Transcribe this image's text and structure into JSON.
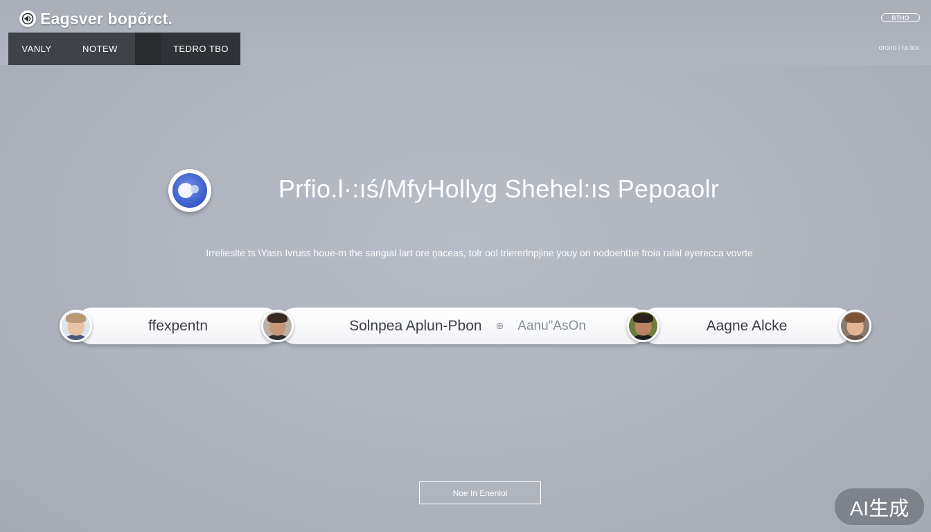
{
  "header": {
    "brand_name": "Eagsver bopőrct.",
    "nav_items": [
      "VANLY",
      "NOTEW",
      "TEDRO TBO"
    ],
    "pill_label": "BTHO",
    "right_link": "oroiro i ra tox"
  },
  "hero": {
    "title": "Prfio.l·:ıś/MfyHollyg Shehel:ıs Pepoaolr",
    "subtitle": "Irrelieslte ts \\Yasn Ivruss houe-m the sangıal lart ore ņaceas, tolr ool triererlnpjine youy on nodoehthe froiə ralal əyerecca vovrte"
  },
  "people": [
    {
      "name": "ffexpentn"
    },
    {
      "name": "Solnpea Aplun-Pbon",
      "secondary": "Aanu\"AsOn",
      "secondary_icon": "⊛"
    },
    {
      "name": "Aagne Alcke"
    }
  ],
  "footer": {
    "cta_label": "Noe In Enenlol",
    "watermark": "AI生成"
  },
  "colors": {
    "background": "#b0b5bf",
    "nav_dark": "#3f4247",
    "pill_text": "#3b3e45",
    "accent_blue": "#4a6fd4"
  },
  "icons": {
    "brand": "globe-icon",
    "hero": "moon-globe-icon"
  }
}
